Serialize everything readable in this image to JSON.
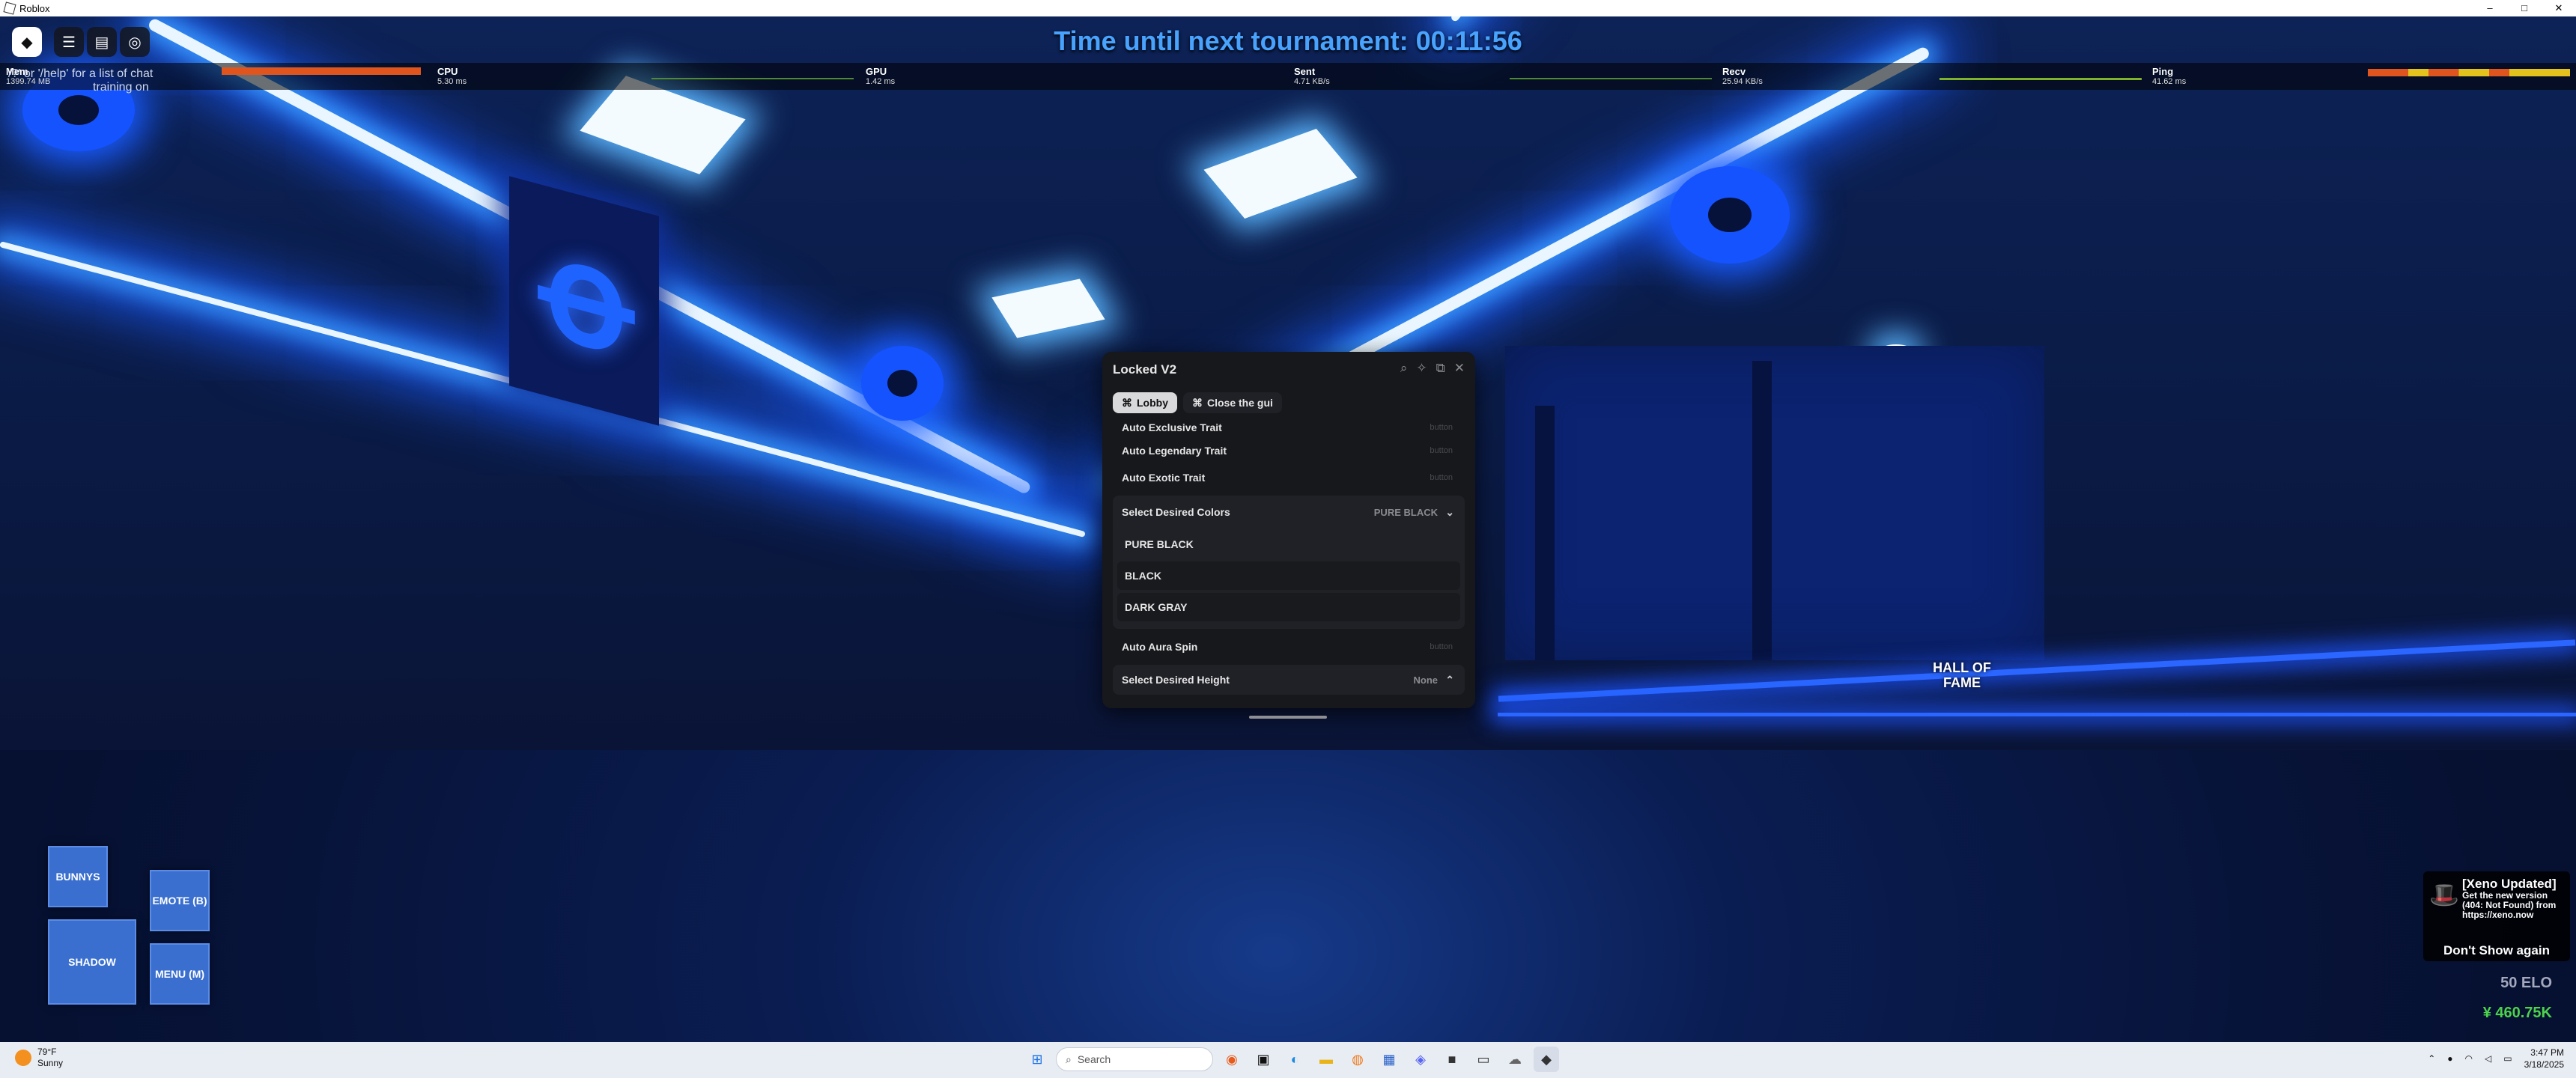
{
  "window": {
    "title": "Roblox",
    "minimize": "–",
    "maximize": "□",
    "close": "✕"
  },
  "hud": {
    "tournament": "Time until next tournament: 00:11:56",
    "chat_hint": [
      "'/?' or '/help' for a list of chat",
      "training on"
    ],
    "stats": [
      {
        "label": "Mem",
        "value": "1399.74 MB"
      },
      {
        "label": "CPU",
        "value": "5.30 ms"
      },
      {
        "label": "GPU",
        "value": "1.42 ms"
      },
      {
        "label": "Sent",
        "value": "4.71 KB/s"
      },
      {
        "label": "Recv",
        "value": "25.94 KB/s"
      },
      {
        "label": "Ping",
        "value": "41.62 ms"
      }
    ]
  },
  "world": {
    "hall_of_fame": "HALL OF FAME"
  },
  "gui": {
    "title": "Locked V2",
    "tabs": [
      {
        "label": "Lobby",
        "active": true
      },
      {
        "label": "Close the gui",
        "active": false
      }
    ],
    "rows": {
      "exclusive": {
        "label": "Auto Exclusive Trait",
        "button": "button"
      },
      "legendary": {
        "label": "Auto Legendary Trait",
        "button": "button"
      },
      "exotic": {
        "label": "Auto Exotic Trait",
        "button": "button"
      },
      "colors": {
        "label": "Select Desired Colors",
        "selected": "PURE BLACK",
        "options": [
          "PURE BLACK",
          "BLACK",
          "DARK GRAY"
        ]
      },
      "aura": {
        "label": "Auto Aura Spin",
        "button": "button"
      },
      "height": {
        "label": "Select Desired Height",
        "selected": "None"
      }
    }
  },
  "side_buttons": {
    "bunnys": "BUNNYS",
    "emote": "EMOTE (B)",
    "shadow": "SHADOW",
    "menu": "MENU (M)"
  },
  "notification": {
    "title": "[Xeno Updated]",
    "body": "Get the new version (404: Not Found) from https://xeno.now",
    "dismiss": "Don't Show again"
  },
  "currency": {
    "elo": "50 ELO",
    "money": "¥ 460.75K"
  },
  "taskbar": {
    "weather_temp": "79°F",
    "weather_desc": "Sunny",
    "search_placeholder": "Search",
    "time": "3:47 PM",
    "date": "3/18/2025"
  }
}
